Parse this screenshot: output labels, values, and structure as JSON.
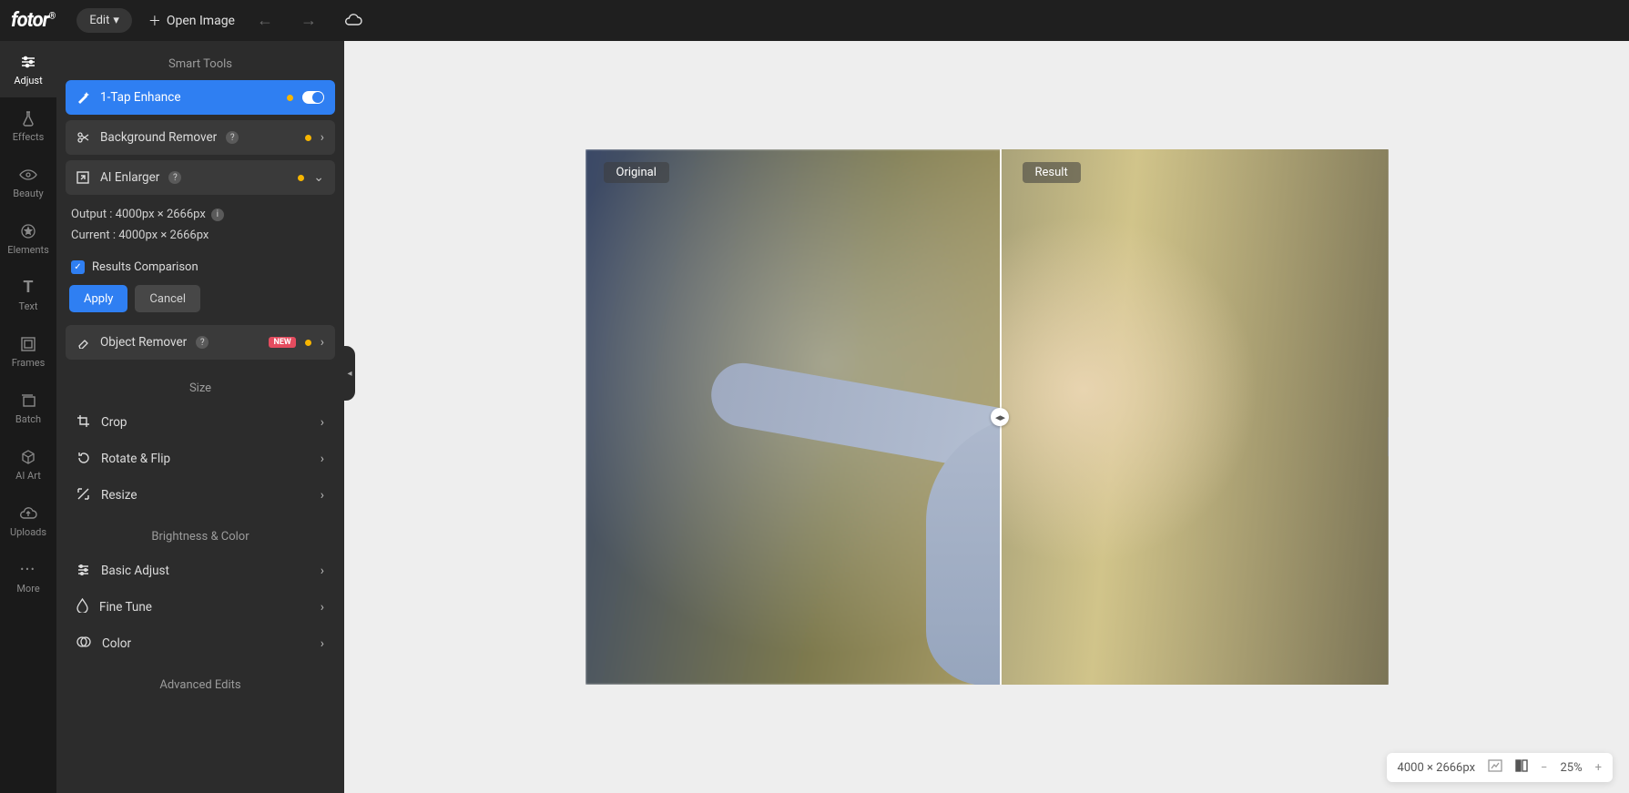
{
  "topbar": {
    "logo": "fotor",
    "edit": "Edit",
    "open_image": "Open Image"
  },
  "rail": [
    {
      "label": "Adjust"
    },
    {
      "label": "Effects"
    },
    {
      "label": "Beauty"
    },
    {
      "label": "Elements"
    },
    {
      "label": "Text"
    },
    {
      "label": "Frames"
    },
    {
      "label": "Batch"
    },
    {
      "label": "AI Art"
    },
    {
      "label": "Uploads"
    },
    {
      "label": "More"
    }
  ],
  "sections": {
    "smart": "Smart Tools",
    "size": "Size",
    "brightness": "Brightness & Color",
    "advanced": "Advanced Edits"
  },
  "smart_tools": {
    "enhance": "1-Tap Enhance",
    "bg_remover": "Background Remover",
    "ai_enlarger": "AI Enlarger",
    "object_remover": "Object Remover",
    "new_badge": "NEW"
  },
  "enlarger": {
    "output": "Output : 4000px × 2666px",
    "current": "Current : 4000px × 2666px",
    "results_compare": "Results Comparison",
    "apply": "Apply",
    "cancel": "Cancel"
  },
  "size_tools": {
    "crop": "Crop",
    "rotate": "Rotate & Flip",
    "resize": "Resize"
  },
  "brightness_tools": {
    "basic": "Basic Adjust",
    "fine": "Fine Tune",
    "color": "Color"
  },
  "compare": {
    "original": "Original",
    "result": "Result"
  },
  "status": {
    "dims": "4000 × 2666px",
    "zoom": "25%"
  }
}
